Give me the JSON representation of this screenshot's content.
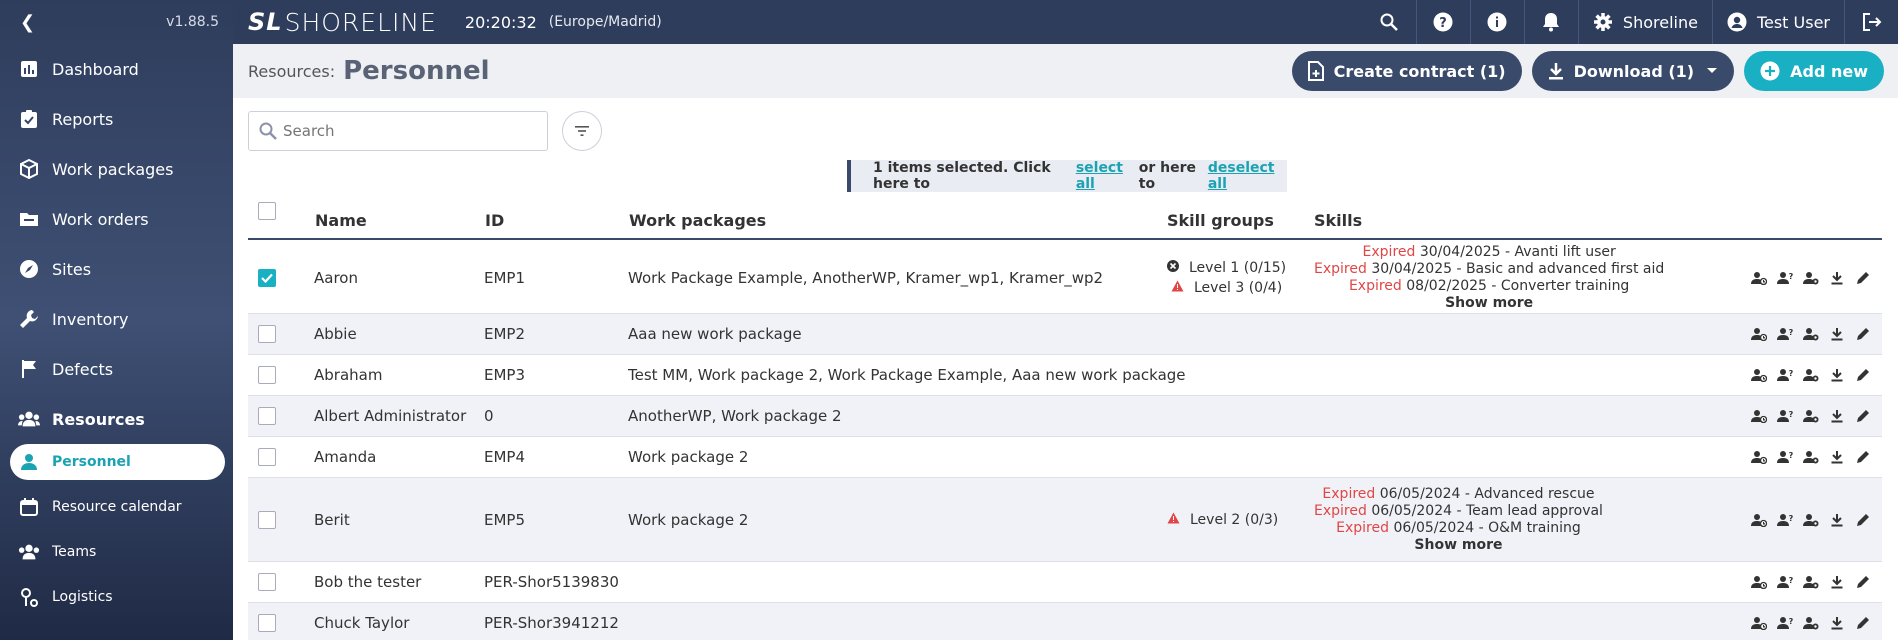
{
  "version": "v1.88.5",
  "header": {
    "logo_mark": "SL",
    "logo_text": "SHORELINE",
    "clock": "20:20:32",
    "timezone": "(Europe/Madrid)",
    "org": "Shoreline",
    "user": "Test User"
  },
  "sidebar": {
    "items": [
      {
        "label": "Dashboard",
        "icon": "chart-icon"
      },
      {
        "label": "Reports",
        "icon": "clipboard-check-icon"
      },
      {
        "label": "Work packages",
        "icon": "cube-icon"
      },
      {
        "label": "Work orders",
        "icon": "folder-icon"
      },
      {
        "label": "Sites",
        "icon": "compass-icon"
      },
      {
        "label": "Inventory",
        "icon": "wrench-icon"
      },
      {
        "label": "Defects",
        "icon": "flag-icon"
      },
      {
        "label": "Resources",
        "icon": "users-icon"
      }
    ],
    "sub": [
      {
        "label": "Personnel",
        "icon": "user-icon"
      },
      {
        "label": "Resource calendar",
        "icon": "calendar-icon"
      },
      {
        "label": "Teams",
        "icon": "users-icon"
      },
      {
        "label": "Logistics",
        "icon": "location-icon"
      }
    ]
  },
  "page": {
    "crumb": "Resources:",
    "title": "Personnel",
    "create_contract": "Create contract (1)",
    "download": "Download (1)",
    "add_new": "Add new"
  },
  "search": {
    "placeholder": "Search"
  },
  "selection": {
    "prefix": "1 items selected. Click here to",
    "select_all": "select all",
    "middle": "or here to",
    "deselect_all": "deselect all"
  },
  "table": {
    "headers": {
      "name": "Name",
      "id": "ID",
      "wp": "Work packages",
      "sg": "Skill groups",
      "skills": "Skills"
    },
    "rows": [
      {
        "name": "Aaron",
        "id": "EMP1",
        "wp": "Work Package Example, AnotherWP, Kramer_wp1, Kramer_wp2",
        "checked": true,
        "sg": [
          {
            "icon": "x-circle-icon",
            "label": "Level 1 (0/15)"
          },
          {
            "icon": "warning-icon",
            "label": "Level 3 (0/4)"
          }
        ],
        "skills": [
          {
            "status": "Expired",
            "text": "30/04/2025 - Avanti lift user"
          },
          {
            "status": "Expired",
            "text": "30/04/2025 - Basic and advanced first aid"
          },
          {
            "status": "Expired",
            "text": "08/02/2025 - Converter training"
          }
        ],
        "more": "Show more"
      },
      {
        "name": "Abbie",
        "id": "EMP2",
        "wp": "Aaa new work package",
        "checked": false,
        "sg": [],
        "skills": [],
        "more": ""
      },
      {
        "name": "Abraham",
        "id": "EMP3",
        "wp": "Test MM, Work package 2, Work Package Example, Aaa new work package",
        "checked": false,
        "sg": [],
        "skills": [],
        "more": ""
      },
      {
        "name": "Albert Administrator",
        "id": "0",
        "wp": "AnotherWP, Work package 2",
        "checked": false,
        "sg": [],
        "skills": [],
        "more": ""
      },
      {
        "name": "Amanda",
        "id": "EMP4",
        "wp": "Work package 2",
        "checked": false,
        "sg": [],
        "skills": [],
        "more": ""
      },
      {
        "name": "Berit",
        "id": "EMP5",
        "wp": "Work package 2",
        "checked": false,
        "sg": [
          {
            "icon": "warning-icon",
            "label": "Level 2 (0/3)"
          }
        ],
        "skills": [
          {
            "status": "Expired",
            "text": "06/05/2024 - Advanced rescue"
          },
          {
            "status": "Expired",
            "text": "06/05/2024 - Team lead approval"
          },
          {
            "status": "Expired",
            "text": "06/05/2024 - O&M training"
          }
        ],
        "more": "Show more"
      },
      {
        "name": "Bob the tester",
        "id": "PER-Shor5139830",
        "wp": "",
        "checked": false,
        "sg": [],
        "skills": [],
        "more": ""
      },
      {
        "name": "Chuck Taylor",
        "id": "PER-Shor3941212",
        "wp": "",
        "checked": false,
        "sg": [],
        "skills": [],
        "more": ""
      }
    ]
  }
}
